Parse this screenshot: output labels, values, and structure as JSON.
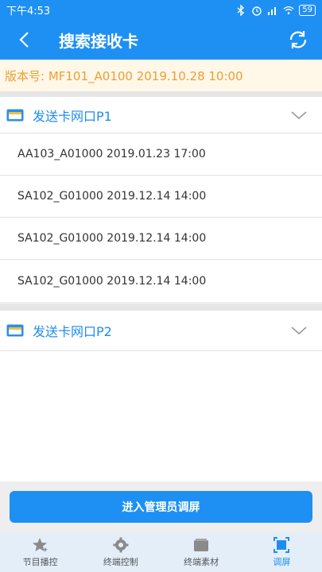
{
  "status": {
    "time": "下午4:53",
    "battery": "59"
  },
  "header": {
    "title": "搜索接收卡"
  },
  "version": {
    "text": "版本号: MF101_A0100 2019.10.28 10:00"
  },
  "groups": [
    {
      "title": "发送卡网口P1",
      "items": [
        "AA103_A01000 2019.01.23 17:00",
        "SA102_G01000 2019.12.14 14:00",
        "SA102_G01000 2019.12.14 14:00",
        "SA102_G01000 2019.12.14 14:00"
      ]
    },
    {
      "title": "发送卡网口P2",
      "items": []
    }
  ],
  "admin_button": "进入管理员调屏",
  "tabs": [
    {
      "label": "节目播控",
      "icon": "star-icon",
      "active": false
    },
    {
      "label": "终端控制",
      "icon": "gear-icon",
      "active": false
    },
    {
      "label": "终端素材",
      "icon": "folder-icon",
      "active": false
    },
    {
      "label": "调屏",
      "icon": "screen-icon",
      "active": true
    }
  ],
  "colors": {
    "primary": "#1e90f3",
    "version_text": "#e8a034",
    "group_title": "#1e8df0"
  }
}
